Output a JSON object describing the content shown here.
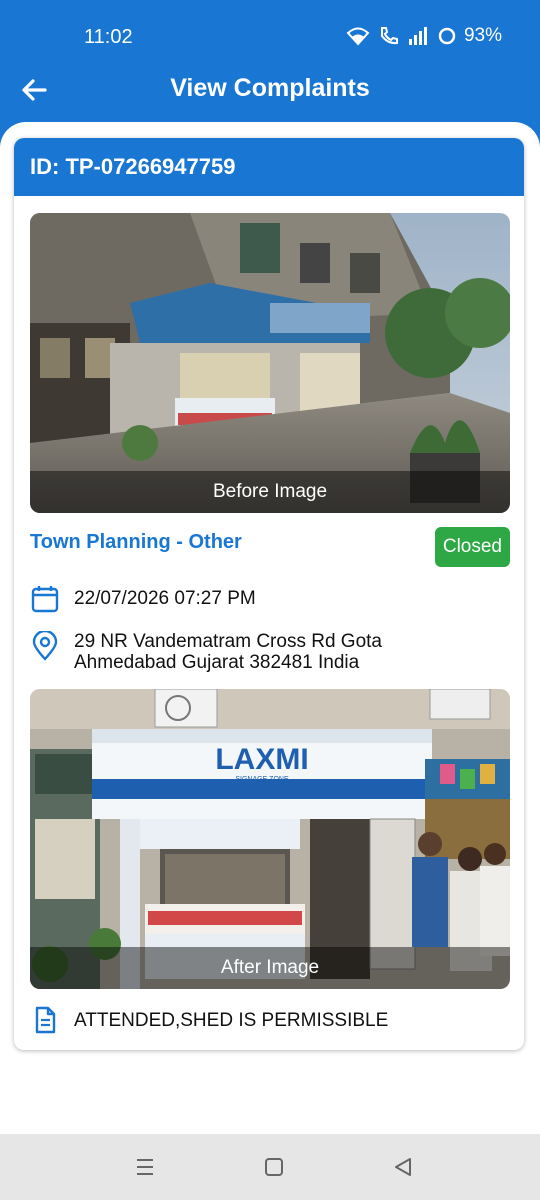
{
  "status_bar": {
    "time": "11:02",
    "battery": "93%"
  },
  "app_bar": {
    "title": "View Complaints",
    "back_icon": "arrow-left-icon"
  },
  "complaint": {
    "id_label": "ID: TP-07266947759",
    "before_image_label": "Before Image",
    "category": "Town Planning - Other",
    "status": "Closed",
    "datetime": "22/07/2026 07:27 PM",
    "address_line1": "29  NR Vandematram Cross Rd  Gota",
    "address_line2": "Ahmedabad  Gujarat 382481  India",
    "after_image_label": "After Image",
    "remark": "ATTENDED,SHED IS PERMISSIBLE",
    "store_sign": "LAXMI",
    "store_sign_sub": "SIGNAGE ZONE"
  },
  "colors": {
    "primary": "#1976D2",
    "status_closed": "#2EA844"
  }
}
